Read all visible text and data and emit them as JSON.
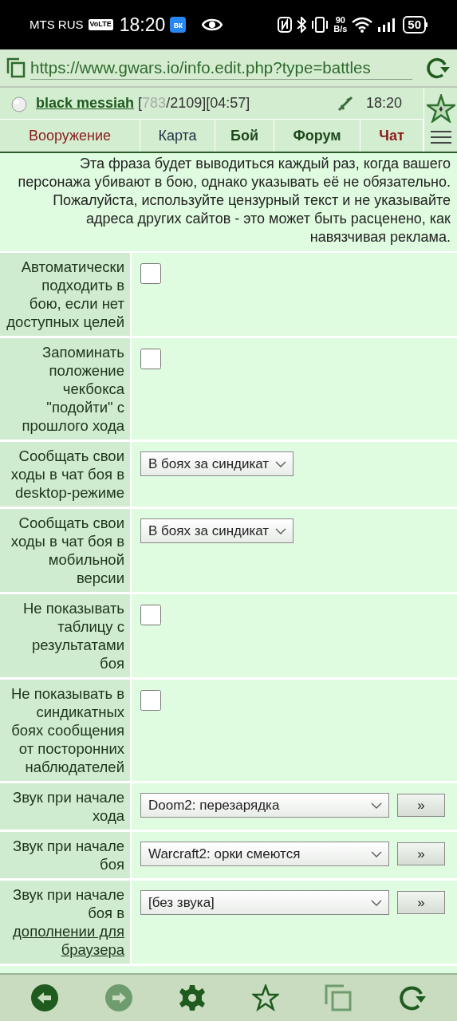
{
  "status_bar": {
    "carrier": "MTS RUS",
    "volte": "VoLTE",
    "time": "18:20",
    "vk": "вк",
    "net_speed": "90",
    "net_unit": "B/s",
    "battery": "50"
  },
  "browser": {
    "url": "https://www.gwars.io/info.edit.php?type=battles"
  },
  "header": {
    "player": "black messiah",
    "hp_open": "[",
    "hp_current": "783",
    "hp_rest": "/2109][04:57]",
    "time": "18:20"
  },
  "nav": [
    {
      "label": "Вооружение",
      "kind": "red"
    },
    {
      "label": "Карта",
      "kind": "plain"
    },
    {
      "label": "Бой",
      "kind": "bold"
    },
    {
      "label": "Форум",
      "kind": "bold"
    },
    {
      "label": "Чат",
      "kind": "redbold"
    }
  ],
  "note": "Эта фраза будет выводиться каждый раз, когда вашего персонажа убивают в бою, однако указывать её не обязательно. Пожалуйста, используйте цензурный текст и не указывайте адреса других сайтов - это может быть расценено, как навязчивая реклама.",
  "settings": [
    {
      "label": "Автоматически подходить в бою, если нет доступных целей",
      "kind": "checkbox",
      "checked": false
    },
    {
      "label": "Запоминать положение чекбокса \"подойти\" с прошлого хода",
      "kind": "checkbox",
      "checked": false
    },
    {
      "label": "Сообщать свои ходы в чат боя в desktop-режиме",
      "kind": "select",
      "value": "В боях за синдикат"
    },
    {
      "label": "Сообщать свои ходы в чат боя в мобильной версии",
      "kind": "select",
      "value": "В боях за синдикат"
    },
    {
      "label": "Не показывать таблицу с результатами боя",
      "kind": "checkbox",
      "checked": false
    },
    {
      "label": "Не показывать в синдикатных боях сообщения от посторонних наблюдателей",
      "kind": "checkbox",
      "checked": false
    },
    {
      "label": "Звук при начале хода",
      "kind": "sound",
      "value": "Doom2: перезарядка",
      "button": "»"
    },
    {
      "label": "Звук при начале боя",
      "kind": "sound",
      "value": "Warcraft2: орки смеются",
      "button": "»"
    },
    {
      "label": "Звук при начале боя в",
      "label_link": "дополнении для браузера",
      "kind": "sound",
      "value": "[без звука]",
      "button": "»"
    }
  ]
}
